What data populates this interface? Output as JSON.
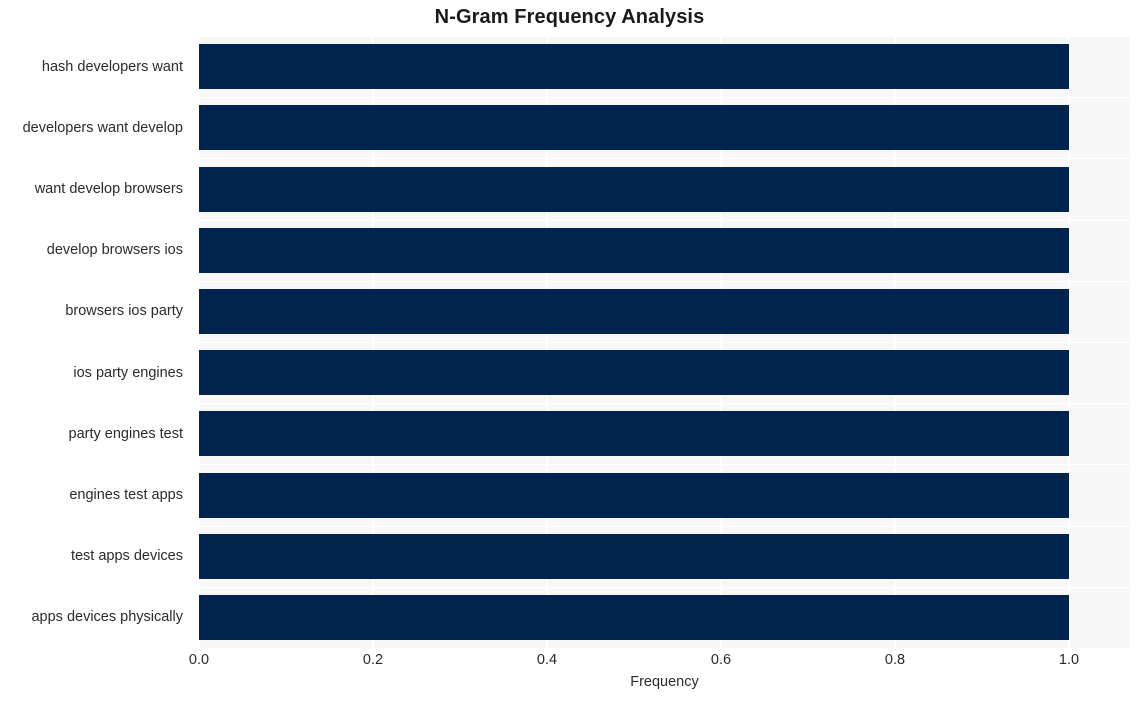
{
  "chart_data": {
    "type": "bar",
    "orientation": "horizontal",
    "title": "N-Gram Frequency Analysis",
    "xlabel": "Frequency",
    "ylabel": "",
    "xlim": [
      0.0,
      1.07
    ],
    "ylim": [
      0,
      10
    ],
    "grid": true,
    "legend": null,
    "bar_color": "#01244e",
    "plot_background": "#f7f7f7",
    "figure_background": "#ffffff",
    "gridline_color": "#ffffff",
    "xticks": [
      "0.0",
      "0.2",
      "0.4",
      "0.6",
      "0.8",
      "1.0"
    ],
    "xtick_values": [
      0.0,
      0.2,
      0.4,
      0.6,
      0.8,
      1.0
    ],
    "categories": [
      "hash developers want",
      "developers want develop",
      "want develop browsers",
      "develop browsers ios",
      "browsers ios party",
      "ios party engines",
      "party engines test",
      "engines test apps",
      "test apps devices",
      "apps devices physically"
    ],
    "values": [
      1.0,
      1.0,
      1.0,
      1.0,
      1.0,
      1.0,
      1.0,
      1.0,
      1.0,
      1.0
    ]
  }
}
